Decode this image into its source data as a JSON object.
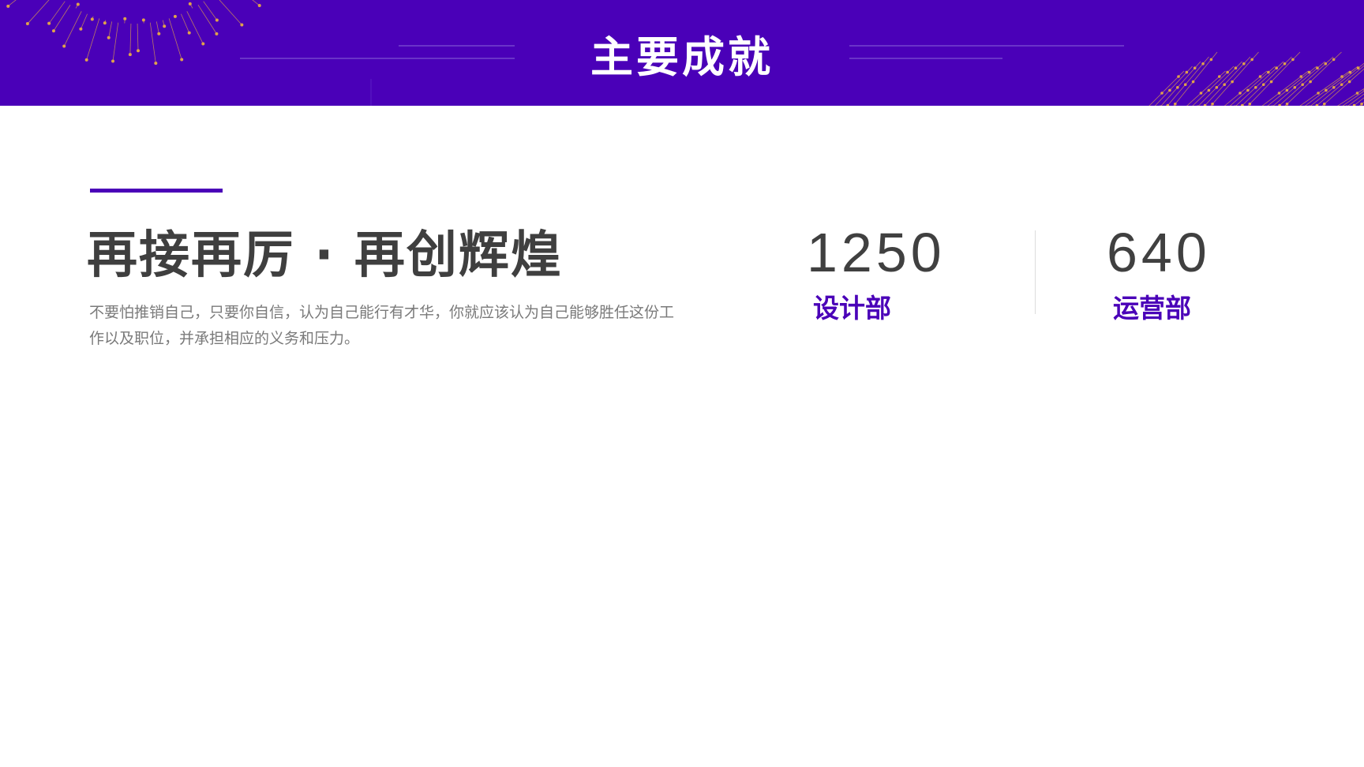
{
  "header": {
    "title": "主要成就"
  },
  "content": {
    "headline": "再接再厉 · 再创辉煌",
    "description": "不要怕推销自己，只要你自信，认为自己能行有才华，你就应该认为自己能够胜任这份工作以及职位，并承担相应的义务和压力。"
  },
  "stats": [
    {
      "number": "1250",
      "label": "设计部"
    },
    {
      "number": "640",
      "label": "运营部"
    }
  ],
  "colors": {
    "primary": "#4a00b8",
    "heading": "#3f3f3f",
    "body_text": "#7a7a7a",
    "decoration_gold": "#e0a24a",
    "background": "#ffffff"
  }
}
